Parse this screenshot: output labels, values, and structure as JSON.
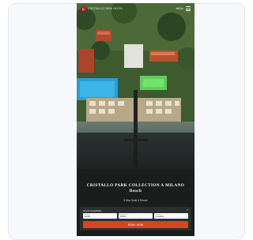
{
  "header": {
    "logo_text": "C",
    "brand": "CRISTALLO PARK HOTEL",
    "menu_label": "MENU"
  },
  "hero": {
    "title_line1": "CRISTALLO PARK COLLECTION A MILANO",
    "title_line2": "Beach",
    "subtitle": "5 Star Hotel & Resort"
  },
  "booking": {
    "heading": "Check Availability",
    "close": "×",
    "fields": [
      {
        "label": "Arrival",
        "value": "01/06"
      },
      {
        "label": "Departure",
        "value": "02/06"
      },
      {
        "label": "Guests",
        "value": "2 Adults"
      }
    ],
    "cta_label": "BOOK NOW"
  },
  "colors": {
    "accent": "#d2471f",
    "logo": "#c8102e",
    "panel": "#2a2e2d"
  }
}
